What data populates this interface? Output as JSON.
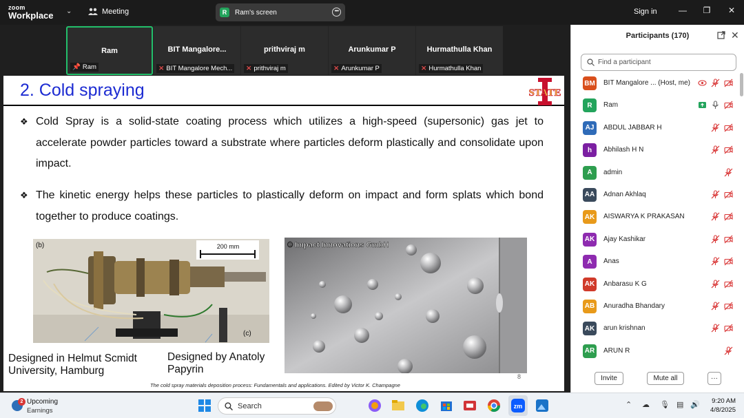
{
  "titlebar": {
    "brand_top": "zoom",
    "brand_bottom": "Workplace",
    "meeting_label": "Meeting",
    "screen_badge": "R",
    "screen_label": "Ram's screen",
    "signin_label": "Sign in"
  },
  "video_strip": [
    {
      "name": "Ram",
      "label": "Ram",
      "pinned": true,
      "muted": false
    },
    {
      "name": "BIT  Mangalore...",
      "label": "BIT Mangalore Mech...",
      "pinned": false,
      "muted": true
    },
    {
      "name": "prithviraj m",
      "label": "prithviraj m",
      "pinned": false,
      "muted": true
    },
    {
      "name": "Arunkumar P",
      "label": "Arunkumar P",
      "pinned": false,
      "muted": true
    },
    {
      "name": "Hurmathulla Khan",
      "label": "Hurmathulla Khan",
      "pinned": false,
      "muted": true
    }
  ],
  "slide": {
    "title": "2. Cold spraying",
    "logo_text": "STATE",
    "bullet1": "Cold Spray is a solid-state coating process which utilizes a high-speed (supersonic) gas jet to accelerate powder particles toward a substrate where particles deform plastically and consolidate upon impact.",
    "bullet2": "The kinetic energy helps these particles to plastically deform on impact and form splats which bond together to produce coatings.",
    "fig_left_b": "(b)",
    "fig_left_c": "(c)",
    "fig_left_scale": "200 mm",
    "fig_right_watermark": "© Impact Innovations GmbH",
    "caption_left": "Designed in Helmut Scmidt University, Hamburg",
    "caption_right": "Designed by Anatoly Papyrin",
    "citation": "The cold spray materials deposition process: Fundamentals and applications. Edited by Victor K. Champagne",
    "page_number": "8"
  },
  "participants": {
    "title": "Participants (170)",
    "search_placeholder": "Find a participant",
    "items": [
      {
        "initials": "BM",
        "name": "BIT Mangalore ...  (Host, me)",
        "color": "#d94f1c",
        "icons": [
          "record",
          "mic-off",
          "video-off"
        ]
      },
      {
        "initials": "R",
        "name": "Ram",
        "color": "#23a45c",
        "icons": [
          "share",
          "mic",
          "video-off"
        ]
      },
      {
        "initials": "AJ",
        "name": "ABDUL JABBAR H",
        "color": "#2f6bb8",
        "icons": [
          "mic-off",
          "video-off"
        ]
      },
      {
        "initials": "h",
        "name": "Abhilash H N",
        "color": "#7b1fa2",
        "icons": [
          "mic-off",
          "video-off"
        ]
      },
      {
        "initials": "A",
        "name": "admin",
        "color": "#2e9e4f",
        "icons": [
          "mic-off"
        ]
      },
      {
        "initials": "AA",
        "name": "Adnan Akhlaq",
        "color": "#3a4a5c",
        "icons": [
          "mic-off",
          "video-off"
        ]
      },
      {
        "initials": "AK",
        "name": "AISWARYA K PRAKASAN",
        "color": "#e89a1a",
        "icons": [
          "mic-off",
          "video-off"
        ]
      },
      {
        "initials": "AK",
        "name": "Ajay Kashikar",
        "color": "#8e2bb0",
        "icons": [
          "mic-off",
          "video-off"
        ]
      },
      {
        "initials": "A",
        "name": "Anas",
        "color": "#8e2bb0",
        "icons": [
          "mic-off",
          "video-off"
        ]
      },
      {
        "initials": "AK",
        "name": "Anbarasu K G",
        "color": "#d03a2a",
        "icons": [
          "mic-off",
          "video-off"
        ]
      },
      {
        "initials": "AB",
        "name": "Anuradha Bhandary",
        "color": "#e89a1a",
        "icons": [
          "mic-off",
          "video-off"
        ]
      },
      {
        "initials": "AK",
        "name": "arun krishnan",
        "color": "#3a4a5c",
        "icons": [
          "mic-off",
          "video-off"
        ]
      },
      {
        "initials": "AR",
        "name": "ARUN R",
        "color": "#2e9e4f",
        "icons": [
          "mic-off"
        ]
      }
    ],
    "invite_label": "Invite",
    "mute_all_label": "Mute all",
    "more_label": "···"
  },
  "taskbar": {
    "weather_title": "Upcoming",
    "weather_sub": "Earnings",
    "weather_badge": "2",
    "search_label": "Search",
    "time": "9:20 AM",
    "date": "4/8/2025"
  }
}
